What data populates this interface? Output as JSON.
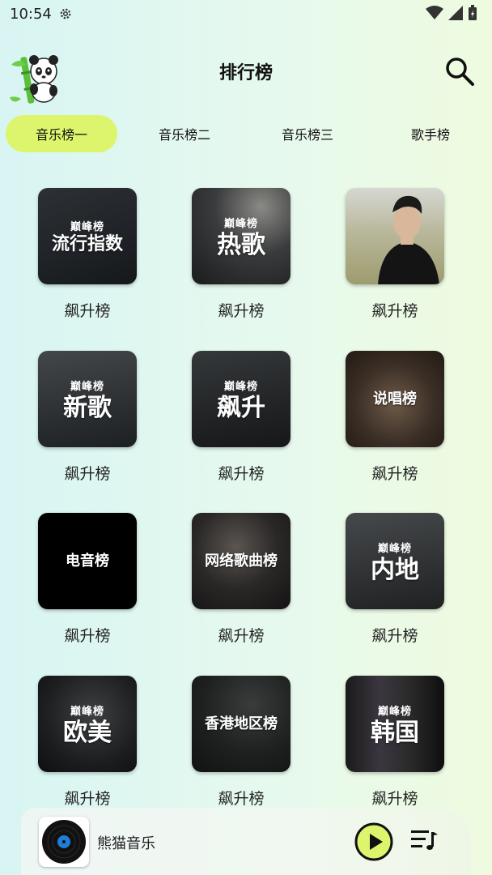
{
  "status": {
    "time": "10:54"
  },
  "header": {
    "title": "排行榜"
  },
  "tabs": [
    {
      "label": "音乐榜一",
      "active": true
    },
    {
      "label": "音乐榜二",
      "active": false
    },
    {
      "label": "音乐榜三",
      "active": false
    },
    {
      "label": "歌手榜",
      "active": false
    }
  ],
  "cards": [
    {
      "brand": "巅峰榜",
      "cover_text": "流行指数",
      "label": "飙升榜",
      "bg": "#1f2226"
    },
    {
      "brand": "巅峰榜",
      "cover_text": "热歌",
      "label": "飙升榜",
      "bg": "#2a2c2e"
    },
    {
      "brand": "",
      "cover_text": "",
      "label": "飙升榜",
      "bg": "#a9a68a"
    },
    {
      "brand": "巅峰榜",
      "cover_text": "新歌",
      "label": "飙升榜",
      "bg": "#2b2d2e"
    },
    {
      "brand": "巅峰榜",
      "cover_text": "飙升",
      "label": "飙升榜",
      "bg": "#1f2224"
    },
    {
      "brand": "",
      "cover_text": "说唱榜",
      "label": "飙升榜",
      "bg": "#3a2e26"
    },
    {
      "brand": "",
      "cover_text": "电音榜",
      "label": "飙升榜",
      "bg": "#000000"
    },
    {
      "brand": "",
      "cover_text": "网络歌曲榜",
      "label": "飙升榜",
      "bg": "#242424"
    },
    {
      "brand": "巅峰榜",
      "cover_text": "内地",
      "label": "飙升榜",
      "bg": "#2b2d2e"
    },
    {
      "brand": "巅峰榜",
      "cover_text": "欧美",
      "label": "飙升榜",
      "bg": "#1b1d1f"
    },
    {
      "brand": "",
      "cover_text": "香港地区榜",
      "label": "飙升榜",
      "bg": "#1e2020"
    },
    {
      "brand": "巅峰榜",
      "cover_text": "韩国",
      "label": "飙升榜",
      "bg": "#141414"
    }
  ],
  "player": {
    "title": "熊猫音乐"
  },
  "colors": {
    "accent": "#dcf56c",
    "play_button": "#dcf56c"
  }
}
